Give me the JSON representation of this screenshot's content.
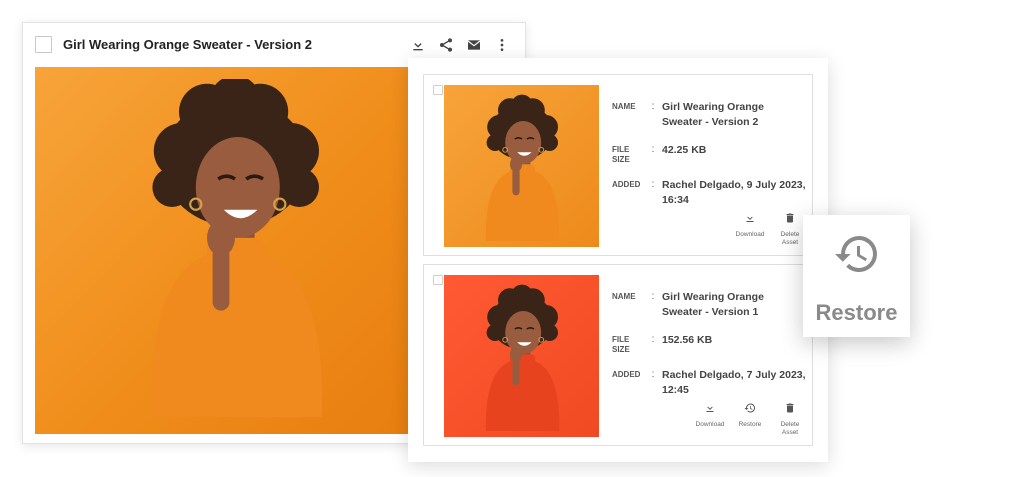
{
  "main": {
    "title": "Girl Wearing Orange Sweater - Version 2",
    "actions": {
      "download": "download-icon",
      "share": "share-icon",
      "email": "email-icon",
      "more": "more-vertical-icon"
    }
  },
  "labels": {
    "name": "NAME",
    "file_size": "FILE SIZE",
    "added": "ADDED",
    "download": "Download",
    "restore": "Restore",
    "delete": "Delete Asset"
  },
  "versions": [
    {
      "name": "Girl Wearing Orange Sweater - Version 2",
      "file_size": "42.25 KB",
      "added": "Rachel Delgado, 9 July 2023, 16:34"
    },
    {
      "name": "Girl Wearing Orange Sweater - Version 1",
      "file_size": "152.56 KB",
      "added": "Rachel Delgado, 7 July 2023, 12:45"
    }
  ],
  "restore_callout": {
    "label": "Restore",
    "icon": "restore-history-icon"
  },
  "colors": {
    "photo_orange": "#f39a2a",
    "photo_red": "#f5522a",
    "icon_gray": "#8a8a8a"
  }
}
